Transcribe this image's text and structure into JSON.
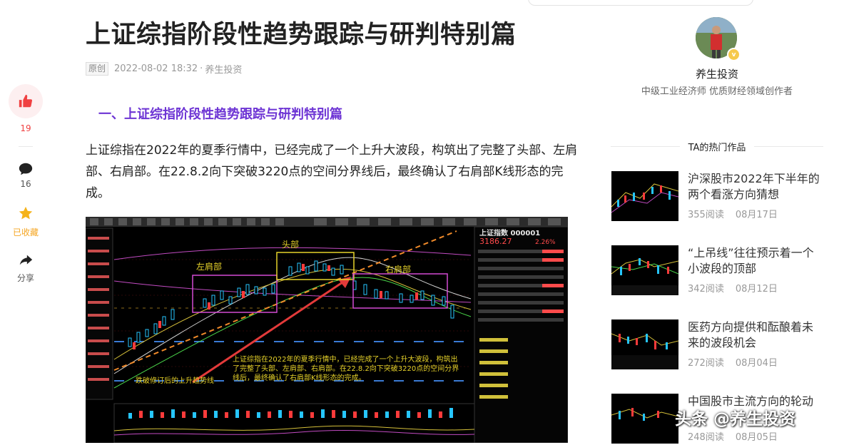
{
  "article": {
    "title": "上证综指阶段性趋势跟踪与研判特别篇",
    "original_badge": "原创",
    "datetime": "2022-08-02 18:32",
    "separator": "·",
    "author": "养生投资",
    "section_heading": "一、上证综指阶段性趋势跟踪与研判特别篇",
    "paragraph": "上证综指在2022年的夏季行情中，已经完成了一个上升大波段，构筑出了完整了头部、左肩部、右肩部。在22.8.2向下突破3220点的空间分界线后，最终确认了右肩部K线形态的完成。"
  },
  "rail": {
    "like_count": "19",
    "comment_count": "16",
    "favorite_label": "已收藏",
    "share_label": "分享"
  },
  "chart_image": {
    "index_name": "上证指数 000001",
    "price": "3186.27",
    "change_pct": "2.26%",
    "label_head": "头部",
    "label_left_shoulder": "左肩部",
    "label_right_shoulder": "右肩部",
    "trendline_caption": "跌破修订后的上升趋势线",
    "overlay_text": "上证综指在2022年的夏季行情中，已经完成了一个上升大波段，构筑出了完整了头部、左肩部、右肩部。在22.8.2向下突破3220点的空间分界线后，最终确认了右肩部K线形态的完成。"
  },
  "sidebar": {
    "author_name": "养生投资",
    "author_desc": "中级工业经济师 优质财经领域创作者",
    "hot_heading": "TA的热门作品",
    "items": [
      {
        "title": "沪深股市2022年下半年的两个看涨方向猜想",
        "reads": "355阅读",
        "date": "08月17日"
      },
      {
        "title": "“上吊线”往往预示着一个小波段的顶部",
        "reads": "342阅读",
        "date": "08月12日"
      },
      {
        "title": "医药方向提供和酝酿着未来的波段机会",
        "reads": "272阅读",
        "date": "08月04日"
      },
      {
        "title": "中国股市主流方向的轮动",
        "reads": "248阅读",
        "date": "08月05日"
      }
    ]
  },
  "watermark": "头条 @养生投资",
  "colors": {
    "accent_red": "#f04142",
    "heading_purple": "#6d34d4",
    "favorite_gold": "#f5b31a"
  }
}
